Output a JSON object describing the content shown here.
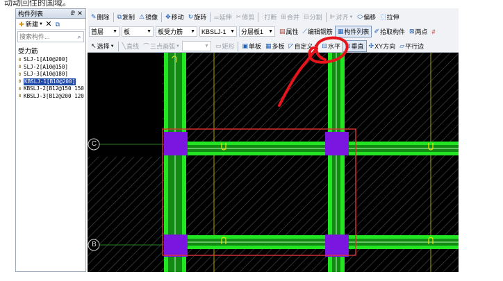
{
  "caption": "动动回住的国域。",
  "panel": {
    "title": "构件列表",
    "pin_icon": "pin-icon",
    "close_icon": "close-icon",
    "new_label": "新建",
    "search_placeholder": "搜索构件...",
    "root_label": "受力筋",
    "items": [
      {
        "label": "SLJ-1[A10@200]"
      },
      {
        "label": "SLJ-2[A10@150]"
      },
      {
        "label": "SLJ-3[A10@180]"
      },
      {
        "label": "KBSLJ-1[B10@200]"
      },
      {
        "label": "KBSLJ-2[B12@150 150"
      },
      {
        "label": "KBSLJ-3[B12@200 120"
      }
    ],
    "selected_index": 3
  },
  "toolbar1": {
    "delete": "删除",
    "copy": "复制",
    "mirror": "镜像",
    "move": "移动",
    "rotate": "旋转",
    "extend": "延伸",
    "trim": "修剪",
    "break": "打断",
    "merge": "合并",
    "split": "分割",
    "align": "对齐",
    "offset": "偏移",
    "stretch": "拉伸"
  },
  "toolbar2": {
    "floor": "首层",
    "category": "板",
    "type": "板受力筋",
    "component": "KBSLJ-1",
    "layer": "分层板1",
    "properties": "属性",
    "edit_rebar": "编辑钢筋",
    "component_list": "构件列表",
    "pick_component": "拾取构件",
    "two_points": "两点"
  },
  "toolbar3": {
    "select": "选择",
    "line": "直线",
    "arc3": "三点画弧",
    "rect": "矩形",
    "single_slab": "单板",
    "multi_slab": "多板",
    "custom": "自定义",
    "horizontal": "水平",
    "vertical": "垂直",
    "xy_dir": "XY方向",
    "parallel": "平行边"
  },
  "canvas": {
    "axis_c": "C",
    "axis_b": "B",
    "colors": {
      "background": "#000000",
      "beam": "#22e622",
      "column": "#7a16e0",
      "hatch": "#4a4a4a",
      "rebar_marker": "#f2e600",
      "selection": "#e03030",
      "annotation": "#e8141c"
    }
  }
}
